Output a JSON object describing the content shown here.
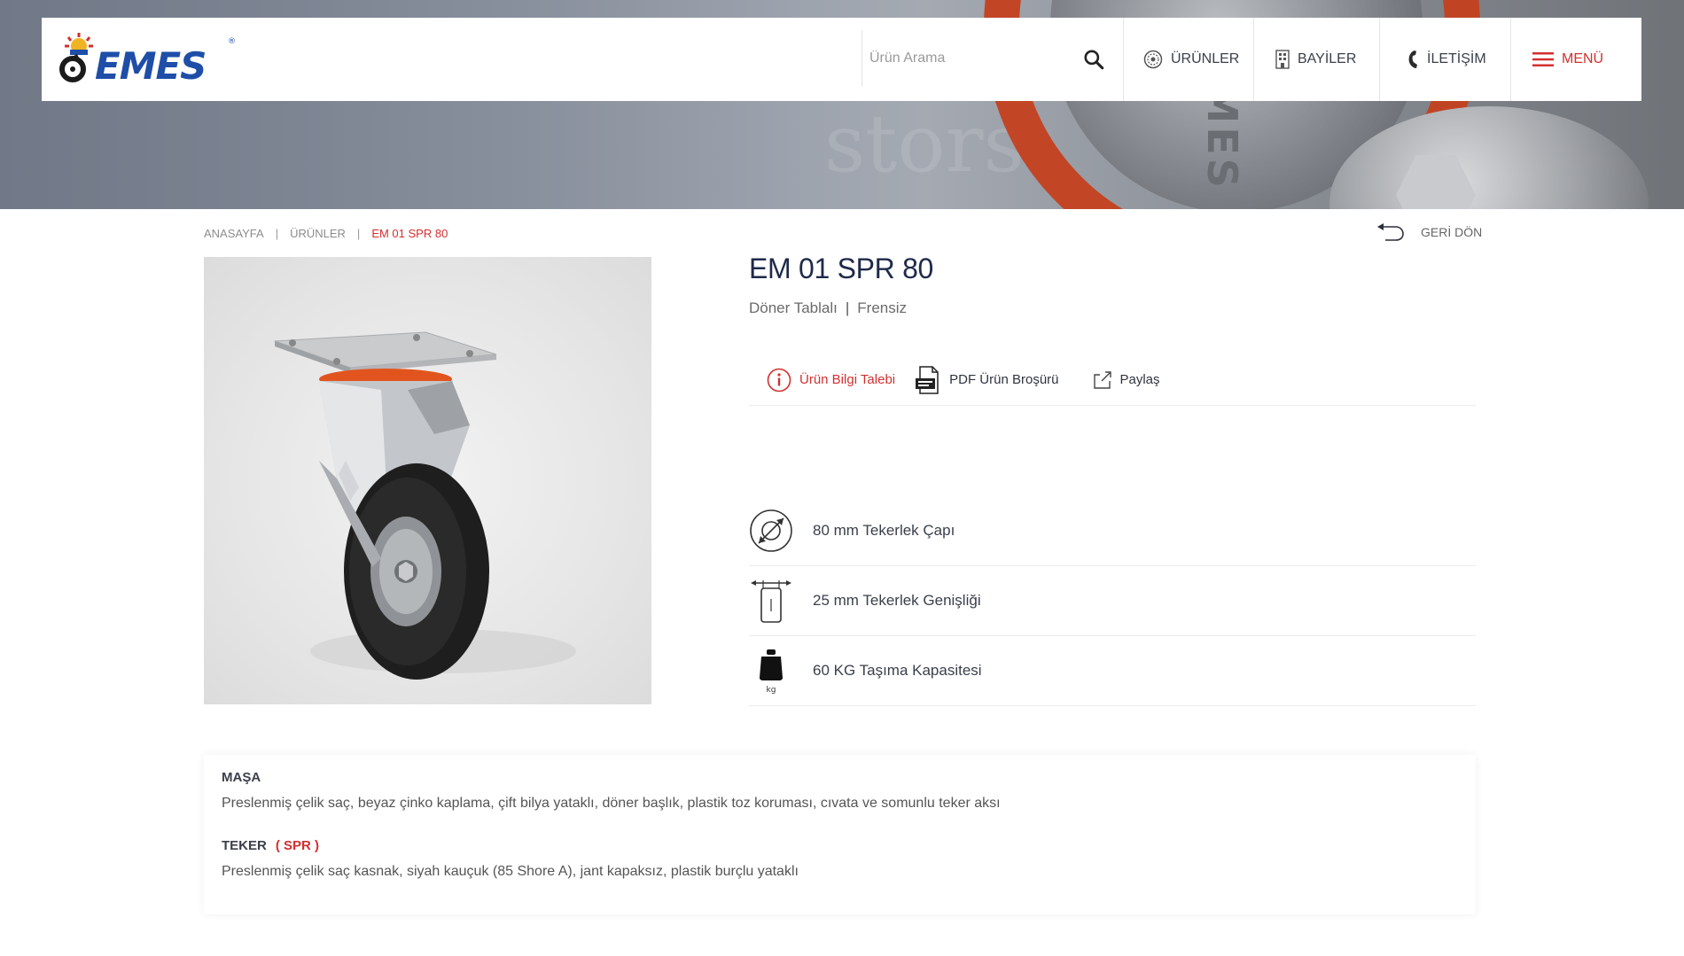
{
  "brand": {
    "logo_text": "EMES",
    "registered_mark": "®"
  },
  "hero": {
    "embossed_text": "EMES",
    "watermark_text": "stors"
  },
  "header": {
    "search_placeholder": "Ürün Arama",
    "nav": {
      "urunler": "ÜRÜNLER",
      "bayiler": "BAYİLER",
      "iletisim": "İLETİŞİM",
      "menu": "MENÜ"
    }
  },
  "breadcrumb": {
    "home": "ANASAYFA",
    "products": "ÜRÜNLER",
    "current": "EM 01 SPR 80",
    "separator": "|"
  },
  "back_label": "GERİ DÖN",
  "product": {
    "title": "EM 01 SPR 80",
    "type": "Döner Tablalı",
    "brake": "Frensiz",
    "separator": "|",
    "actions": {
      "info_request": "Ürün Bilgi Talebi",
      "pdf_brochure": "PDF Ürün Broşürü",
      "share": "Paylaş"
    },
    "specs": [
      {
        "icon": "diameter-icon",
        "text": "80 mm Tekerlek Çapı"
      },
      {
        "icon": "width-icon",
        "text": "25 mm Tekerlek Genişliği"
      },
      {
        "icon": "weight-icon",
        "text": "60 KG Taşıma Kapasitesi",
        "icon_label": "kg"
      }
    ]
  },
  "description": {
    "masa_heading": "MAŞA",
    "masa_text": "Preslenmiş çelik saç, beyaz çinko kaplama, çift bilya yataklı, döner başlık, plastik toz koruması, cıvata ve somunlu teker aksı",
    "teker_heading": "TEKER",
    "teker_code": "( SPR )",
    "teker_text": "Preslenmiş çelik saç kasnak, siyah kauçuk (85 Shore A), jant kapaksız, plastik burçlu yataklı"
  },
  "colors": {
    "accent_red": "#d32f2f",
    "brand_blue": "#1e4ea8",
    "title_navy": "#1f2a4a",
    "wheel_orange": "#e2541e"
  }
}
